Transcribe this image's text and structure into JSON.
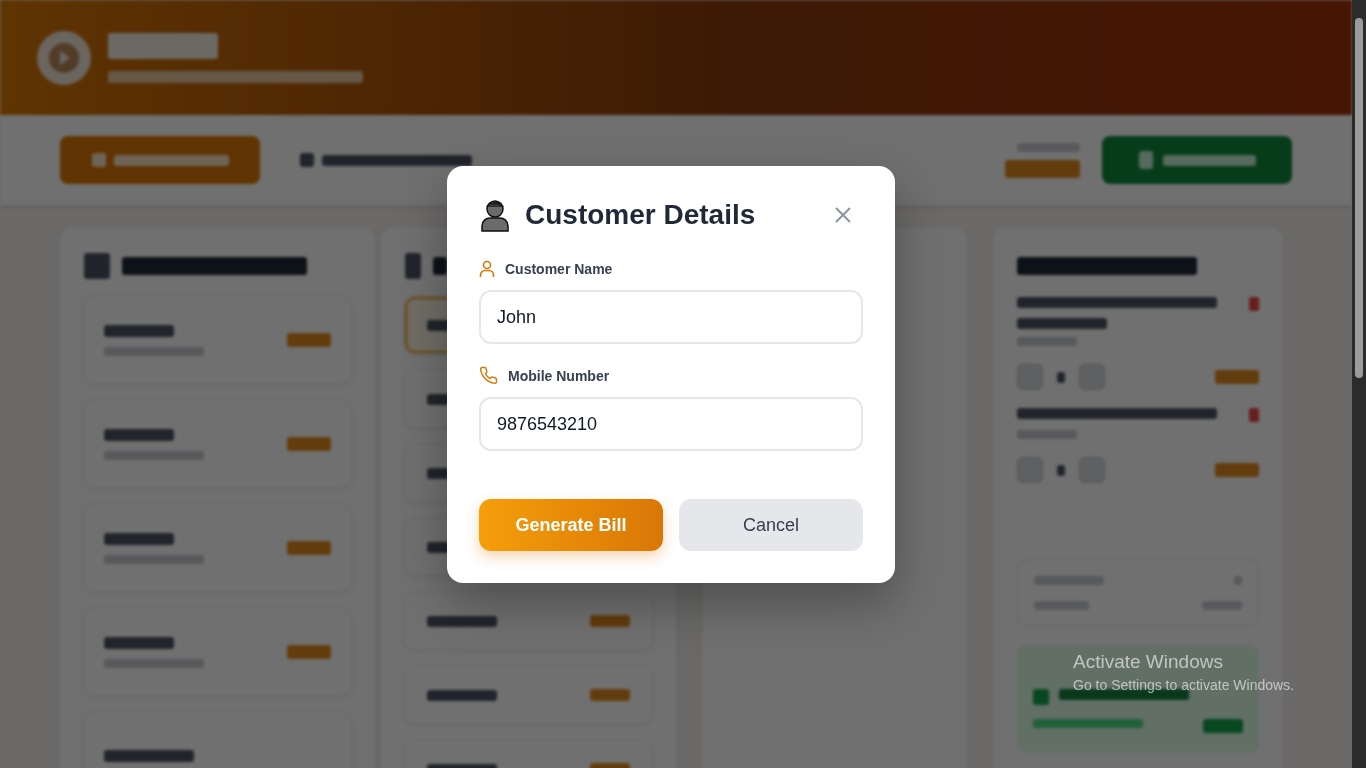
{
  "dialog": {
    "title": "Customer Details",
    "fields": [
      {
        "kind": "name",
        "label": "Customer Name",
        "value": "John"
      },
      {
        "kind": "phone",
        "label": "Mobile Number",
        "value": "9876543210"
      }
    ],
    "primary": "Generate Bill",
    "secondary": "Cancel"
  },
  "os_notice": {
    "title": "Activate Windows",
    "text": "Go to Settings to activate Windows."
  }
}
